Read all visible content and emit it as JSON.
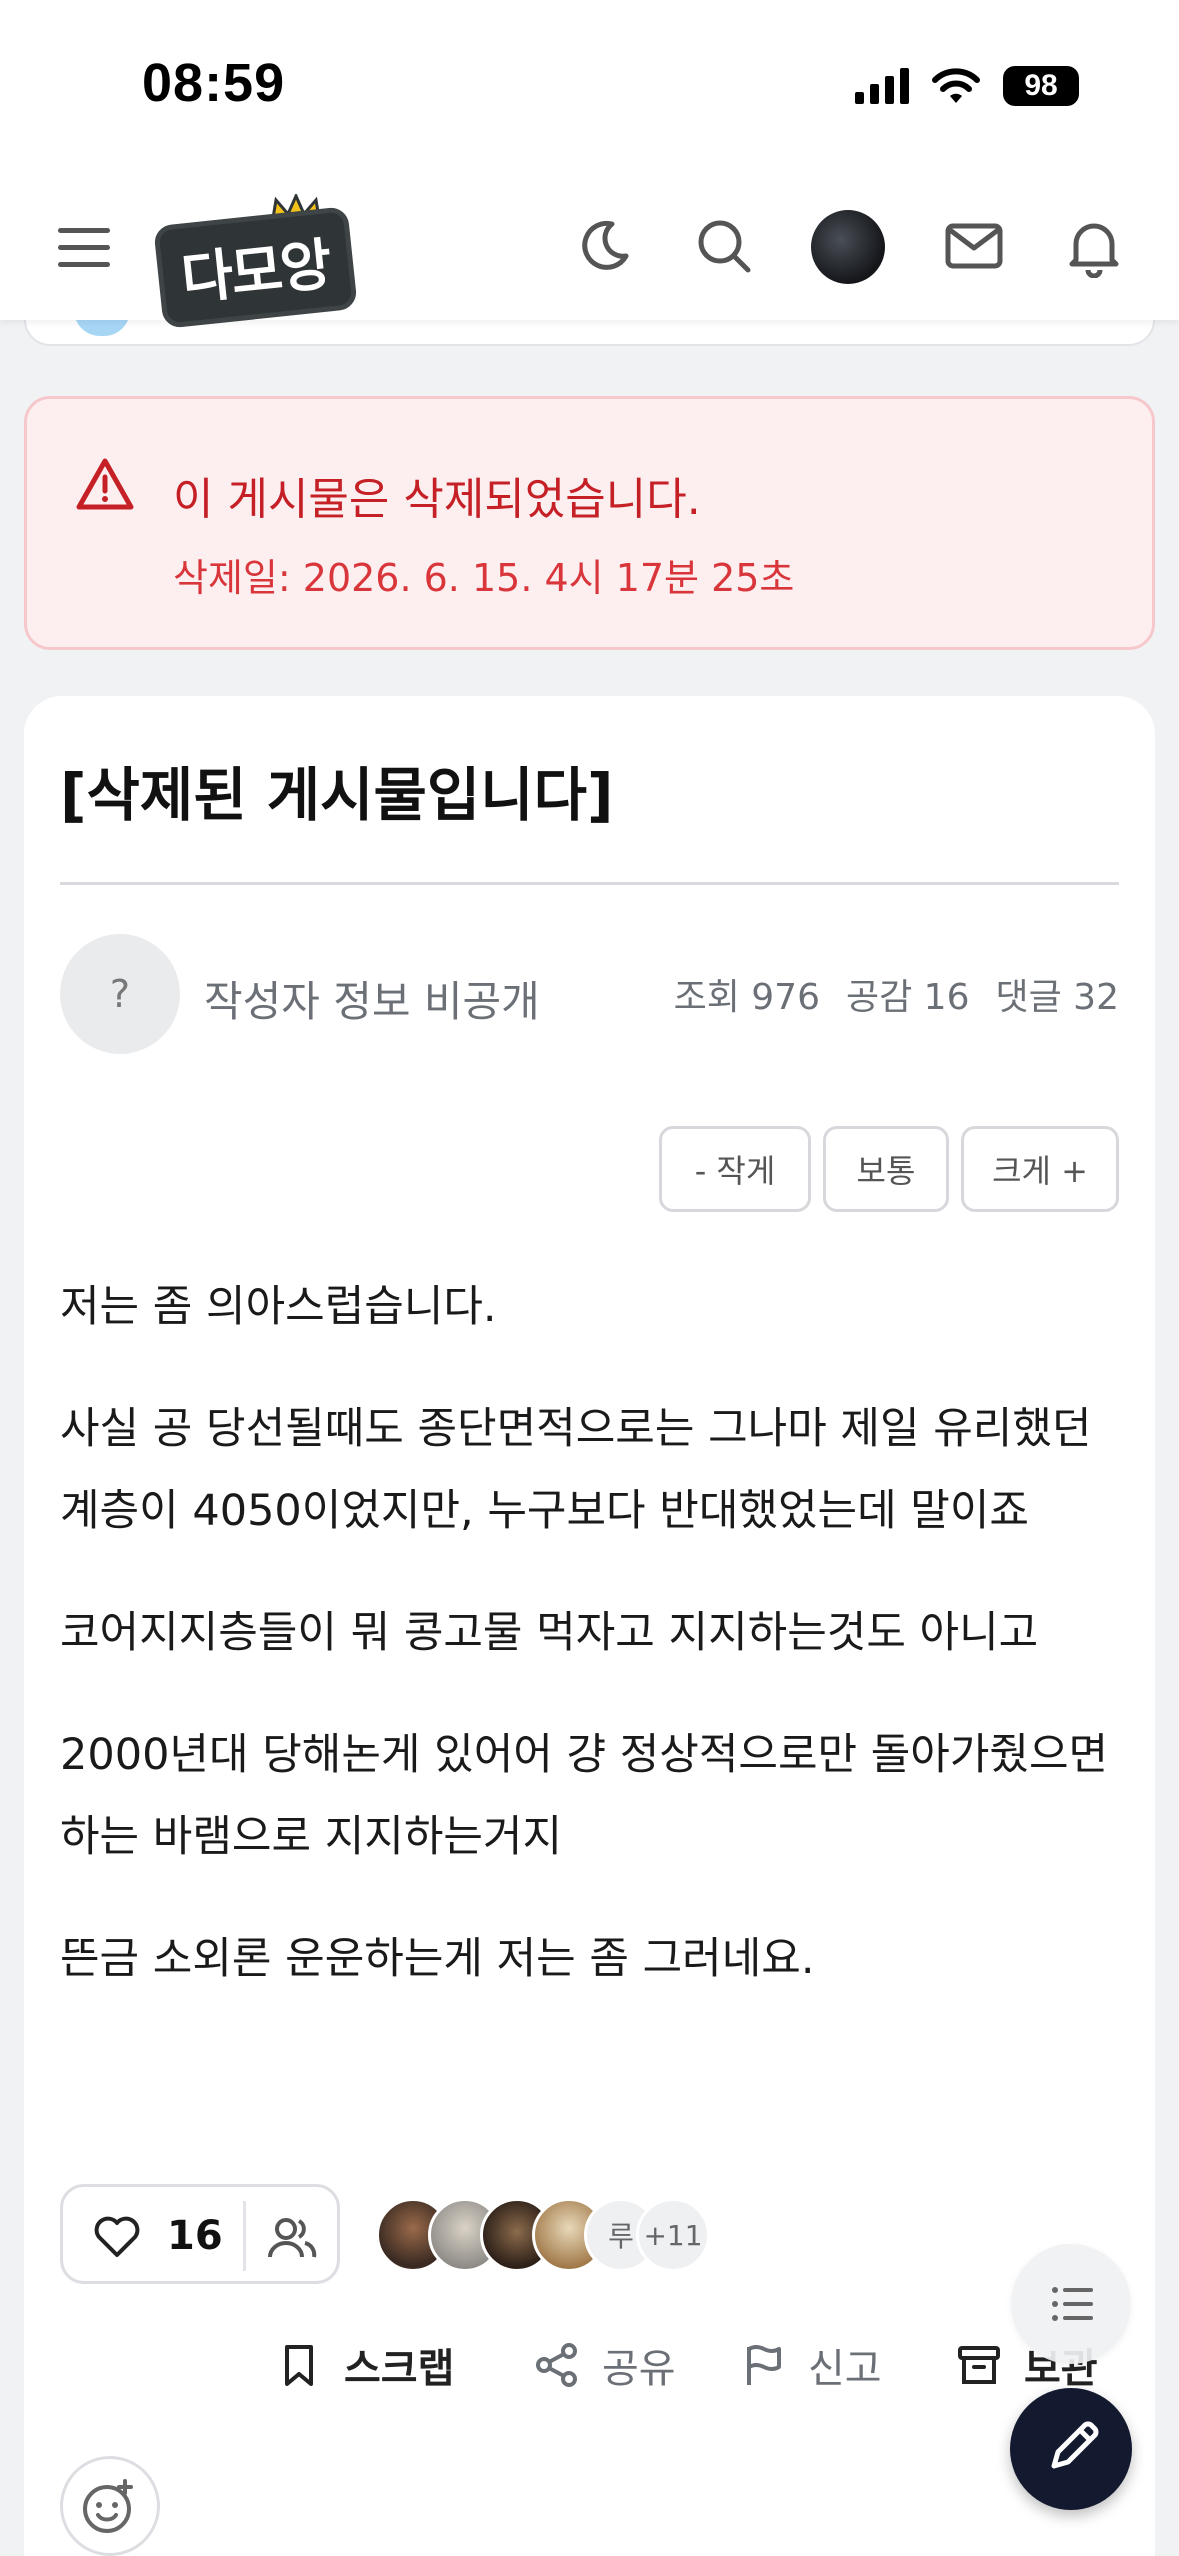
{
  "status_bar": {
    "time": "08:59",
    "battery": "98"
  },
  "header": {
    "logo_text": "다모앙",
    "icons": [
      "menu-icon",
      "moon-icon",
      "search-icon",
      "avatar",
      "mail-icon",
      "bell-icon"
    ]
  },
  "notice": {
    "title": "이 게시물은 삭제되었습니다.",
    "date": "삭제일: 2026. 6. 15. 4시 17분 25초",
    "color": "#c42026"
  },
  "post": {
    "title": "[삭제된 게시물입니다]",
    "author_avatar": "?",
    "author": "작성자 정보 비공개",
    "views": "조회 976",
    "likes_stat": "공감 16",
    "comments": "댓글 32",
    "size_buttons": [
      "- 작게",
      "보통",
      "크게 +"
    ],
    "paragraphs": [
      "저는 좀 의아스럽습니다.",
      "사실 공 당선될때도 종단면적으로는 그나마 제일 유리했던 계층이 4050이었지만, 누구보다 반대했었는데 말이죠",
      "코어지지층들이 뭐 콩고물 먹자고 지지하는것도 아니고",
      "2000년대 당해논게 있어어 걍 정상적으로만 돌아가줬으면 하는 바램으로 지지하는거지",
      "뜬금 소외론 운운하는게 저는 좀 그러네요."
    ]
  },
  "reactions": {
    "like_count": "16",
    "avatar_text": "루",
    "more": "+11"
  },
  "actions": {
    "scrap": "스크랩",
    "share": "공유",
    "report": "신고",
    "archive": "보관"
  }
}
